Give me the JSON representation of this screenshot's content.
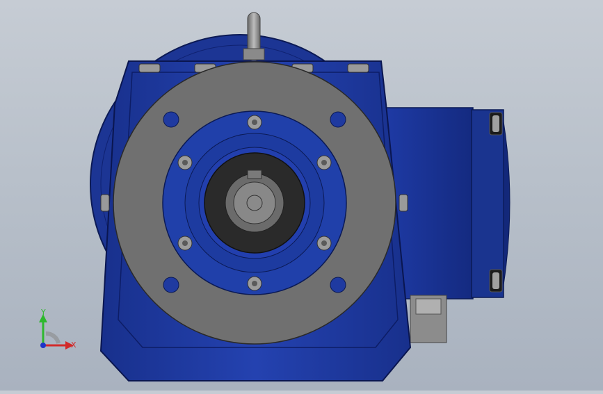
{
  "viewport": {
    "background_top": "#c6ccd4",
    "background_bottom": "#a9b2bf",
    "model_color": "#1f3aa0",
    "flange_color": "#6e6e6e"
  },
  "triad": {
    "y_label": "Y",
    "x_label": "X",
    "y_color": "#2db82d",
    "x_color": "#d22a2a",
    "z_color": "#1f35c8"
  }
}
